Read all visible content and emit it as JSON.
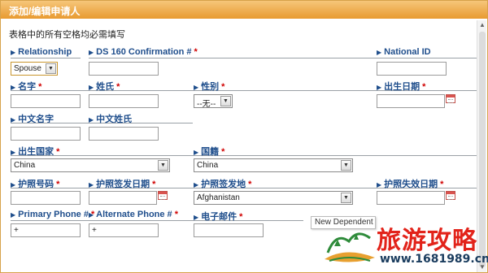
{
  "dialog": {
    "title": "添加/编辑申请人",
    "notice": "表格中的所有空格均必需填写"
  },
  "req_mark": "*",
  "fields": {
    "relationship": {
      "label": "Relationship",
      "value": "Spouse"
    },
    "ds160": {
      "label": "DS 160 Confirmation #",
      "value": ""
    },
    "national_id": {
      "label": "National ID",
      "value": ""
    },
    "given_name": {
      "label": "名字",
      "value": ""
    },
    "surname": {
      "label": "姓氏",
      "value": ""
    },
    "gender": {
      "label": "性别",
      "value": "--无--"
    },
    "dob": {
      "label": "出生日期",
      "value": ""
    },
    "cn_given_name": {
      "label": "中文名字",
      "value": ""
    },
    "cn_surname": {
      "label": "中文姓氏",
      "value": ""
    },
    "birth_country": {
      "label": "出生国家",
      "value": "China"
    },
    "nationality": {
      "label": "国籍",
      "value": "China"
    },
    "passport_no": {
      "label": "护照号码",
      "value": ""
    },
    "passport_issue_date": {
      "label": "护照签发日期",
      "value": ""
    },
    "passport_issue_place": {
      "label": "护照签发地",
      "value": "Afghanistan"
    },
    "passport_expiry": {
      "label": "护照失效日期",
      "value": ""
    },
    "primary_phone": {
      "label": "Primary Phone #",
      "value": "+"
    },
    "alternate_phone": {
      "label": "Alternate Phone #",
      "value": "+"
    },
    "email": {
      "label": "电子邮件",
      "value": ""
    }
  },
  "tooltip": {
    "text": "New Dependent"
  },
  "watermark": {
    "text": "旅游攻略",
    "url": "www.1681989.cn"
  },
  "icons": {
    "section_arrow": "triangle-right-icon",
    "dropdown": "chevron-down-icon",
    "calendar": "calendar-icon"
  },
  "colors": {
    "title_bar": "#e89a30",
    "label_blue": "#1f4e8c",
    "required_red": "#d00000",
    "watermark_red": "#e2231a"
  }
}
